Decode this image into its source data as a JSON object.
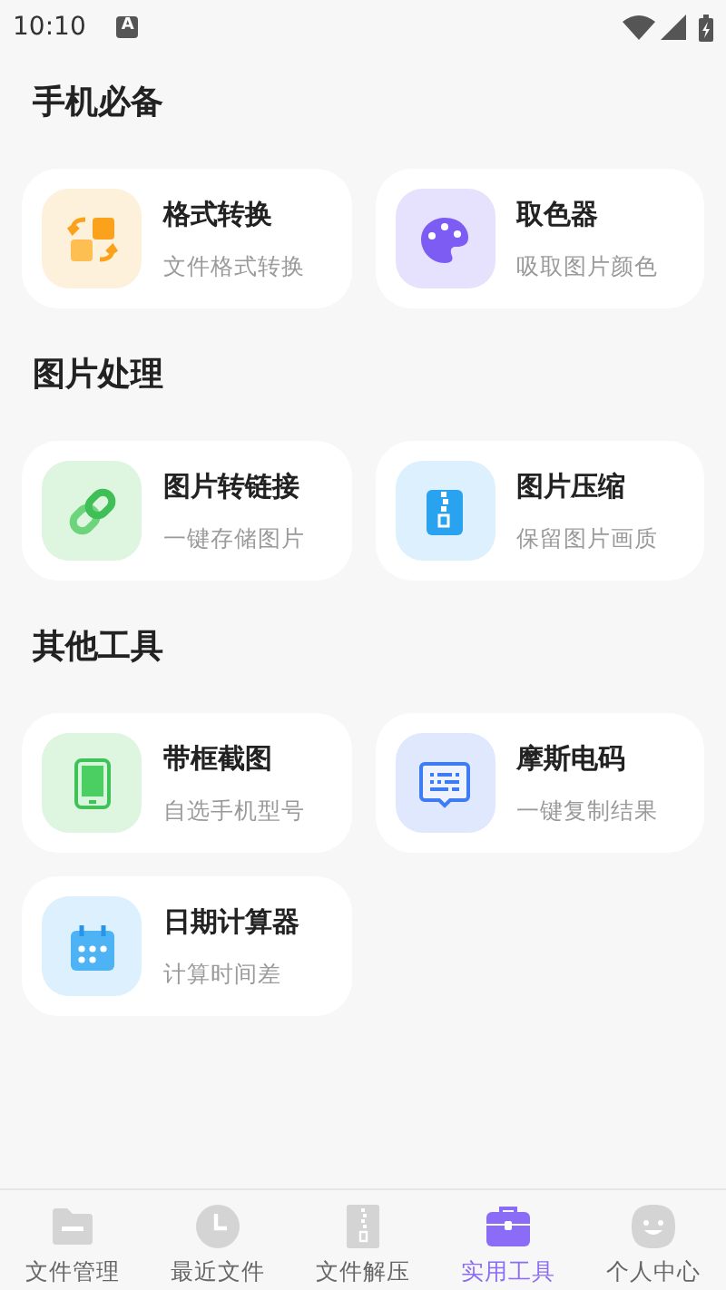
{
  "status_bar": {
    "time": "10:10",
    "badge": "A"
  },
  "sections": [
    {
      "title": "手机必备",
      "tools": [
        {
          "name": "格式转换",
          "desc": "文件格式转换"
        },
        {
          "name": "取色器",
          "desc": "吸取图片颜色"
        }
      ]
    },
    {
      "title": "图片处理",
      "tools": [
        {
          "name": "图片转链接",
          "desc": "一键存储图片"
        },
        {
          "name": "图片压缩",
          "desc": "保留图片画质"
        }
      ]
    },
    {
      "title": "其他工具",
      "tools": [
        {
          "name": "带框截图",
          "desc": "自选手机型号"
        },
        {
          "name": "摩斯电码",
          "desc": "一键复制结果"
        },
        {
          "name": "日期计算器",
          "desc": "计算时间差"
        }
      ]
    }
  ],
  "bottom_nav": [
    {
      "label": "文件管理",
      "selected": false
    },
    {
      "label": "最近文件",
      "selected": false
    },
    {
      "label": "文件解压",
      "selected": false
    },
    {
      "label": "实用工具",
      "selected": true
    },
    {
      "label": "个人中心",
      "selected": false
    }
  ]
}
